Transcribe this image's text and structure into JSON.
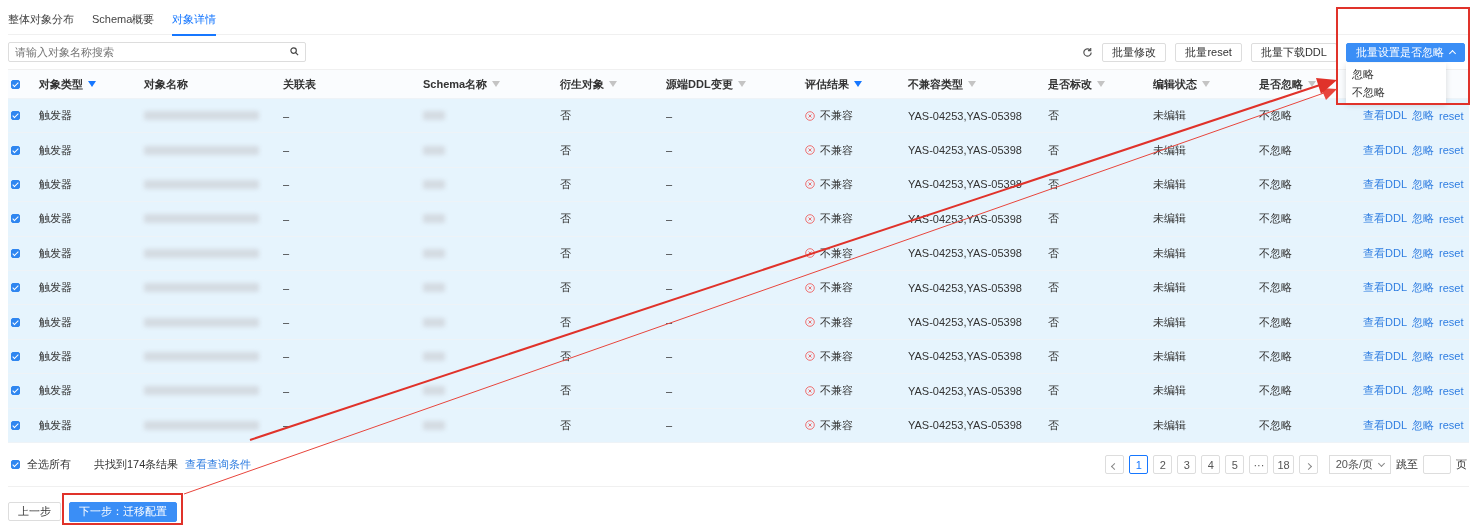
{
  "tabs": [
    {
      "label": "整体对象分布",
      "selected": false
    },
    {
      "label": "Schema概要",
      "selected": false
    },
    {
      "label": "对象详情",
      "selected": true
    }
  ],
  "search": {
    "placeholder": "请输入对象名称搜索"
  },
  "toolbar": {
    "buttons": [
      "批量修改",
      "批量reset",
      "批量下载DDL"
    ],
    "dropdown": {
      "label": "批量设置是否忽略",
      "expanded": true,
      "options": [
        "忽略",
        "不忽略"
      ]
    }
  },
  "table": {
    "all_selected": true,
    "columns": [
      {
        "label": "对象类型",
        "filter": {
          "active": true
        }
      },
      {
        "label": "对象名称"
      },
      {
        "label": "关联表"
      },
      {
        "label": "Schema名称",
        "filter": {
          "active": false
        }
      },
      {
        "label": "衍生对象",
        "filter": {
          "active": false
        }
      },
      {
        "label": "源端DDL变更",
        "filter": {
          "active": false
        }
      },
      {
        "label": "评估结果",
        "filter": {
          "active": true
        }
      },
      {
        "label": "不兼容类型",
        "filter": {
          "active": false
        }
      },
      {
        "label": "是否标改",
        "filter": {
          "active": false
        }
      },
      {
        "label": "编辑状态",
        "filter": {
          "active": false
        }
      },
      {
        "label": "是否忽略",
        "filter": {
          "active": false
        }
      }
    ],
    "rows": [
      {
        "selected": true,
        "type": "触发器",
        "related": "–",
        "derived": "否",
        "ddl_change": "–",
        "result": "不兼容",
        "incompat": "YAS-04253,YAS-05398",
        "marked": "否",
        "edit_state": "未编辑",
        "ignore": "不忽略",
        "actions": [
          "查看DDL",
          "忽略",
          "reset"
        ]
      },
      {
        "selected": true,
        "type": "触发器",
        "related": "–",
        "derived": "否",
        "ddl_change": "–",
        "result": "不兼容",
        "incompat": "YAS-04253,YAS-05398",
        "marked": "否",
        "edit_state": "未编辑",
        "ignore": "不忽略",
        "actions": [
          "查看DDL",
          "忽略",
          "reset"
        ]
      },
      {
        "selected": true,
        "type": "触发器",
        "related": "–",
        "derived": "否",
        "ddl_change": "–",
        "result": "不兼容",
        "incompat": "YAS-04253,YAS-05398",
        "marked": "否",
        "edit_state": "未编辑",
        "ignore": "不忽略",
        "actions": [
          "查看DDL",
          "忽略",
          "reset"
        ]
      },
      {
        "selected": true,
        "type": "触发器",
        "related": "–",
        "derived": "否",
        "ddl_change": "–",
        "result": "不兼容",
        "incompat": "YAS-04253,YAS-05398",
        "marked": "否",
        "edit_state": "未编辑",
        "ignore": "不忽略",
        "actions": [
          "查看DDL",
          "忽略",
          "reset"
        ]
      },
      {
        "selected": true,
        "type": "触发器",
        "related": "–",
        "derived": "否",
        "ddl_change": "–",
        "result": "不兼容",
        "incompat": "YAS-04253,YAS-05398",
        "marked": "否",
        "edit_state": "未编辑",
        "ignore": "不忽略",
        "actions": [
          "查看DDL",
          "忽略",
          "reset"
        ]
      },
      {
        "selected": true,
        "type": "触发器",
        "related": "–",
        "derived": "否",
        "ddl_change": "–",
        "result": "不兼容",
        "incompat": "YAS-04253,YAS-05398",
        "marked": "否",
        "edit_state": "未编辑",
        "ignore": "不忽略",
        "actions": [
          "查看DDL",
          "忽略",
          "reset"
        ]
      },
      {
        "selected": true,
        "type": "触发器",
        "related": "–",
        "derived": "否",
        "ddl_change": "–",
        "result": "不兼容",
        "incompat": "YAS-04253,YAS-05398",
        "marked": "否",
        "edit_state": "未编辑",
        "ignore": "不忽略",
        "actions": [
          "查看DDL",
          "忽略",
          "reset"
        ]
      },
      {
        "selected": true,
        "type": "触发器",
        "related": "–",
        "derived": "否",
        "ddl_change": "–",
        "result": "不兼容",
        "incompat": "YAS-04253,YAS-05398",
        "marked": "否",
        "edit_state": "未编辑",
        "ignore": "不忽略",
        "actions": [
          "查看DDL",
          "忽略",
          "reset"
        ]
      },
      {
        "selected": true,
        "type": "触发器",
        "related": "–",
        "derived": "否",
        "ddl_change": "–",
        "result": "不兼容",
        "incompat": "YAS-04253,YAS-05398",
        "marked": "否",
        "edit_state": "未编辑",
        "ignore": "不忽略",
        "actions": [
          "查看DDL",
          "忽略",
          "reset"
        ]
      },
      {
        "selected": true,
        "type": "触发器",
        "related": "–",
        "derived": "否",
        "ddl_change": "–",
        "result": "不兼容",
        "incompat": "YAS-04253,YAS-05398",
        "marked": "否",
        "edit_state": "未编辑",
        "ignore": "不忽略",
        "actions": [
          "查看DDL",
          "忽略",
          "reset"
        ]
      }
    ]
  },
  "footer": {
    "select_all": {
      "label": "全选所有",
      "checked": true
    },
    "count": "共找到174条结果",
    "link": "查看查询条件"
  },
  "pagination": {
    "pages": [
      {
        "label": "1",
        "selected": true
      },
      {
        "label": "2",
        "selected": false
      },
      {
        "label": "3",
        "selected": false
      },
      {
        "label": "4",
        "selected": false
      },
      {
        "label": "5",
        "selected": false
      },
      {
        "label": "···",
        "selected": false
      },
      {
        "label": "18",
        "selected": false
      }
    ],
    "page_size": "20条/页",
    "jump_label": "跳至",
    "page_suffix": "页"
  },
  "nav": {
    "prev": "上一步",
    "next": "下一步：迁移配置"
  }
}
